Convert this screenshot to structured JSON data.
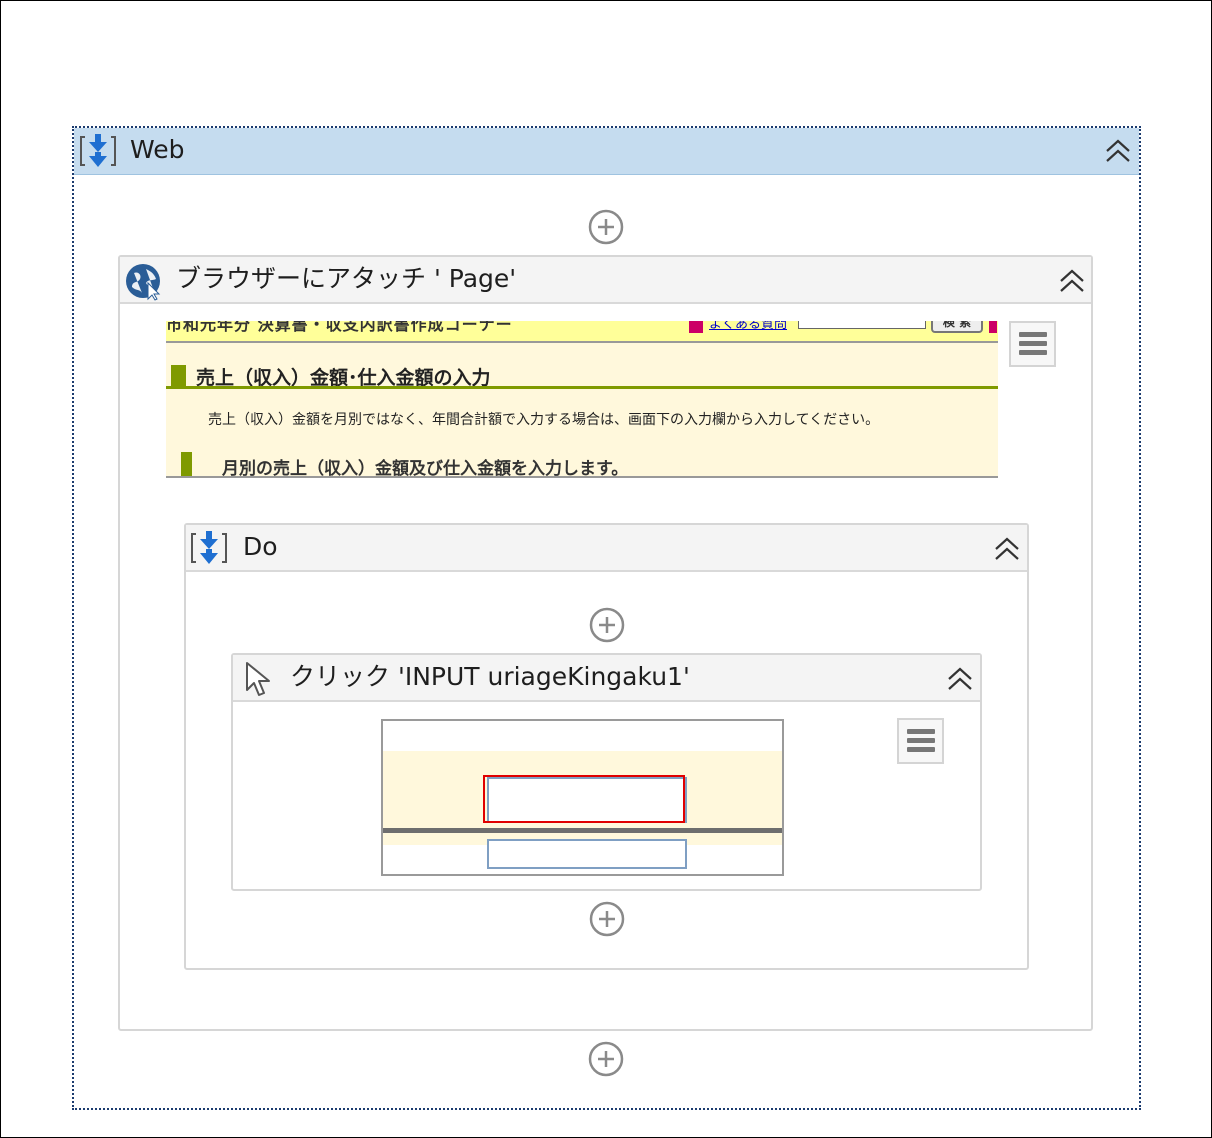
{
  "sequence_web": {
    "title": "Web"
  },
  "attach_browser": {
    "title": "ブラウザーにアタッチ '        Page'"
  },
  "screenshot": {
    "cut_header_text": "市和元年分 決算書・収支内訳書作成コーナー",
    "faq_link": "よくある質問",
    "search_button": "検 索",
    "heading": "売上（収入）金額･仕入金額の入力",
    "note": "売上（収入）金額を月別ではなく、年間合計額で入力する場合は、画面下の入力欄から入力してください。",
    "subheading": "月別の売上（収入）金額及び仕入金額を入力します。"
  },
  "do_sequence": {
    "title": "Do"
  },
  "click_activity": {
    "title": "クリック 'INPUT  uriageKingaku1'"
  },
  "colors": {
    "accent_green": "#7f9a00",
    "selected_header": "#c5dcef",
    "highlight_red": "#e00000",
    "link_blue": "#0000cc"
  }
}
